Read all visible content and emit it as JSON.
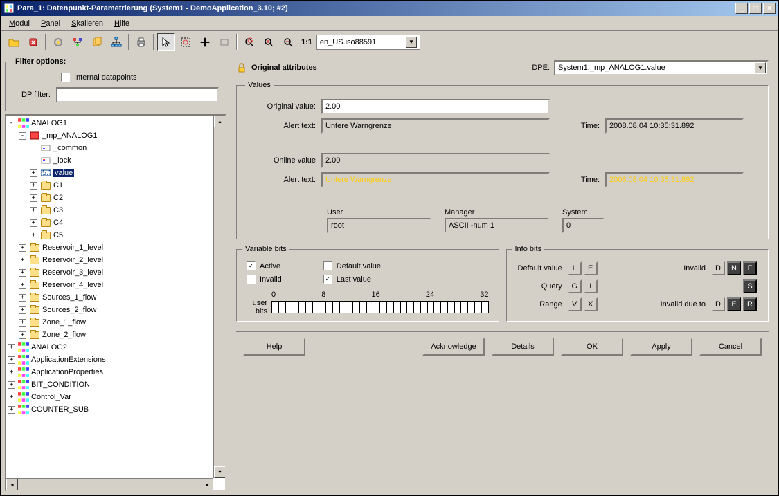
{
  "window": {
    "title": "Para_1: Datenpunkt-Parametrierung (System1 - DemoApplication_3.10; #2)"
  },
  "menu": {
    "modul": "Modul",
    "panel": "Panel",
    "skalieren": "Skalieren",
    "hilfe": "Hilfe"
  },
  "toolbar": {
    "zoom_label": "1:1",
    "encoding": "en_US.iso88591"
  },
  "filter": {
    "legend": "Filter options:",
    "internal_dp": "Internal datapoints",
    "dp_filter_label": "DP filter:",
    "dp_filter_value": ""
  },
  "tree": [
    {
      "depth": 0,
      "exp": "-",
      "icon": "dp",
      "label": "ANALOG1"
    },
    {
      "depth": 1,
      "exp": "-",
      "icon": "dpred",
      "label": "_mp_ANALOG1"
    },
    {
      "depth": 2,
      "exp": "",
      "icon": "leaf",
      "label": "_common"
    },
    {
      "depth": 2,
      "exp": "",
      "icon": "leaf",
      "label": "_lock"
    },
    {
      "depth": 2,
      "exp": "+",
      "icon": "val",
      "label": "value",
      "selected": true
    },
    {
      "depth": 2,
      "exp": "+",
      "icon": "folder",
      "label": "C1"
    },
    {
      "depth": 2,
      "exp": "+",
      "icon": "folder",
      "label": "C2"
    },
    {
      "depth": 2,
      "exp": "+",
      "icon": "folder",
      "label": "C3"
    },
    {
      "depth": 2,
      "exp": "+",
      "icon": "folder",
      "label": "C4"
    },
    {
      "depth": 2,
      "exp": "+",
      "icon": "folder",
      "label": "C5"
    },
    {
      "depth": 1,
      "exp": "+",
      "icon": "folder",
      "label": "Reservoir_1_level"
    },
    {
      "depth": 1,
      "exp": "+",
      "icon": "folder",
      "label": "Reservoir_2_level"
    },
    {
      "depth": 1,
      "exp": "+",
      "icon": "folder",
      "label": "Reservoir_3_level"
    },
    {
      "depth": 1,
      "exp": "+",
      "icon": "folder",
      "label": "Reservoir_4_level"
    },
    {
      "depth": 1,
      "exp": "+",
      "icon": "folder",
      "label": "Sources_1_flow"
    },
    {
      "depth": 1,
      "exp": "+",
      "icon": "folder",
      "label": "Sources_2_flow"
    },
    {
      "depth": 1,
      "exp": "+",
      "icon": "folder",
      "label": "Zone_1_flow"
    },
    {
      "depth": 1,
      "exp": "+",
      "icon": "folder",
      "label": "Zone_2_flow"
    },
    {
      "depth": 0,
      "exp": "+",
      "icon": "dp",
      "label": "ANALOG2"
    },
    {
      "depth": 0,
      "exp": "+",
      "icon": "dp",
      "label": "ApplicationExtensions"
    },
    {
      "depth": 0,
      "exp": "+",
      "icon": "dp",
      "label": "ApplicationProperties"
    },
    {
      "depth": 0,
      "exp": "+",
      "icon": "dp",
      "label": "BIT_CONDITION"
    },
    {
      "depth": 0,
      "exp": "+",
      "icon": "dp",
      "label": "Control_Var"
    },
    {
      "depth": 0,
      "exp": "+",
      "icon": "dp",
      "label": "COUNTER_SUB"
    }
  ],
  "original_attributes": {
    "title": "Original attributes",
    "dpe_label": "DPE:",
    "dpe_value": "System1:_mp_ANALOG1.value"
  },
  "values": {
    "legend": "Values",
    "orig_value_label": "Original value:",
    "orig_value": "2.00",
    "alert_text_label": "Alert text:",
    "orig_alert": "Untere Warngrenze",
    "time_label": "Time:",
    "orig_time": "2008.08.04 10:35:31.892",
    "online_value_label": "Online value",
    "online_value": "2.00",
    "online_alert": "Untere Warngrenze",
    "online_time": "2008.08.04 10:35:31.892",
    "user_label": "User",
    "user": "root",
    "manager_label": "Manager",
    "manager": "ASCII -num 1",
    "system_label": "System",
    "system": "0"
  },
  "variable_bits": {
    "legend": "Variable bits",
    "active": "Active",
    "active_checked": true,
    "invalid": "Invalid",
    "invalid_checked": false,
    "default_value": "Default value",
    "default_checked": false,
    "last_value": "Last value",
    "last_checked": true,
    "user_label": "user",
    "bits_label": "bits",
    "scale": [
      "0",
      "8",
      "16",
      "24",
      "32"
    ]
  },
  "info_bits": {
    "legend": "Info bits",
    "default_value": "Default value",
    "query": "Query",
    "range": "Range",
    "invalid": "Invalid",
    "invalid_due_to": "Invalid due to",
    "L": "L",
    "E": "E",
    "G": "G",
    "I": "I",
    "V": "V",
    "X": "X",
    "D": "D",
    "N": "N",
    "F": "F",
    "S": "S",
    "R": "R"
  },
  "buttons": {
    "help": "Help",
    "acknowledge": "Acknowledge",
    "details": "Details",
    "ok": "OK",
    "apply": "Apply",
    "cancel": "Cancel"
  }
}
